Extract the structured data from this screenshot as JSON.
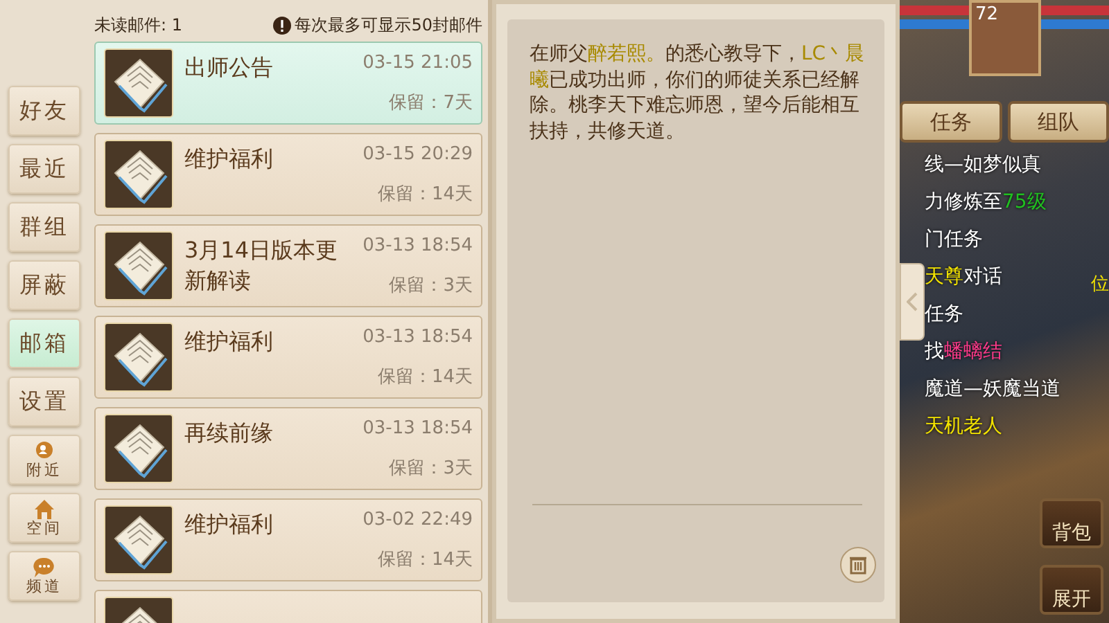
{
  "sidebar": {
    "items": [
      {
        "label": "好友",
        "kind": "text",
        "selected": false
      },
      {
        "label": "最近",
        "kind": "text",
        "selected": false
      },
      {
        "label": "群组",
        "kind": "text",
        "selected": false
      },
      {
        "label": "屏蔽",
        "kind": "text",
        "selected": false
      },
      {
        "label": "邮箱",
        "kind": "text",
        "selected": true
      },
      {
        "label": "设置",
        "kind": "text",
        "selected": false
      },
      {
        "label": "附近",
        "kind": "person",
        "selected": false
      },
      {
        "label": "空间",
        "kind": "home",
        "selected": false
      },
      {
        "label": "频道",
        "kind": "chat",
        "selected": false
      }
    ]
  },
  "mail": {
    "unread_label": "未读邮件: 1",
    "notice": "每次最多可显示50封邮件",
    "items": [
      {
        "title": "出师公告",
        "time": "03-15 21:05",
        "retention": "保留：7天",
        "selected": true
      },
      {
        "title": "维护福利",
        "time": "03-15 20:29",
        "retention": "保留：14天",
        "selected": false
      },
      {
        "title": "3月14日版本更新解读",
        "time": "03-13 18:54",
        "retention": "保留：3天",
        "selected": false
      },
      {
        "title": "维护福利",
        "time": "03-13 18:54",
        "retention": "保留：14天",
        "selected": false
      },
      {
        "title": "再续前缘",
        "time": "03-13 18:54",
        "retention": "保留：3天",
        "selected": false
      },
      {
        "title": "维护福利",
        "time": "03-02 22:49",
        "retention": "保留：14天",
        "selected": false
      }
    ]
  },
  "message": {
    "body": [
      {
        "text": "在师父",
        "highlight": false
      },
      {
        "text": "醉若熙。",
        "highlight": true
      },
      {
        "text": "的悉心教导下，",
        "highlight": false
      },
      {
        "text": "LC丶晨曦",
        "highlight": true
      },
      {
        "text": "已成功出师，你们的师徒关系已经解除。桃李天下难忘师恩，望今后能相互扶持，共修天道。",
        "highlight": false
      }
    ]
  },
  "game": {
    "level": "72",
    "buttons": [
      "任务",
      "组队"
    ],
    "quests": [
      [
        {
          "text": "线—如梦似真",
          "kind": "plain"
        }
      ],
      [
        {
          "text": "力修炼至",
          "kind": "plain"
        },
        {
          "text": "75级",
          "kind": "goal"
        }
      ],
      [
        {
          "text": "门任务",
          "kind": "plain"
        }
      ],
      [
        {
          "text": "天尊",
          "kind": "npc"
        },
        {
          "text": "对话",
          "kind": "plain"
        }
      ],
      [
        {
          "text": "任务",
          "kind": "plain"
        }
      ],
      [
        {
          "text": "找",
          "kind": "plain"
        },
        {
          "text": "蟠螭结",
          "kind": "item"
        }
      ],
      [
        {
          "text": "魔道—妖魔当道",
          "kind": "plain"
        }
      ],
      [
        {
          "text": "天机老人",
          "kind": "npc"
        }
      ]
    ],
    "side_label": "位",
    "bag": "背包",
    "expand": "展开"
  }
}
